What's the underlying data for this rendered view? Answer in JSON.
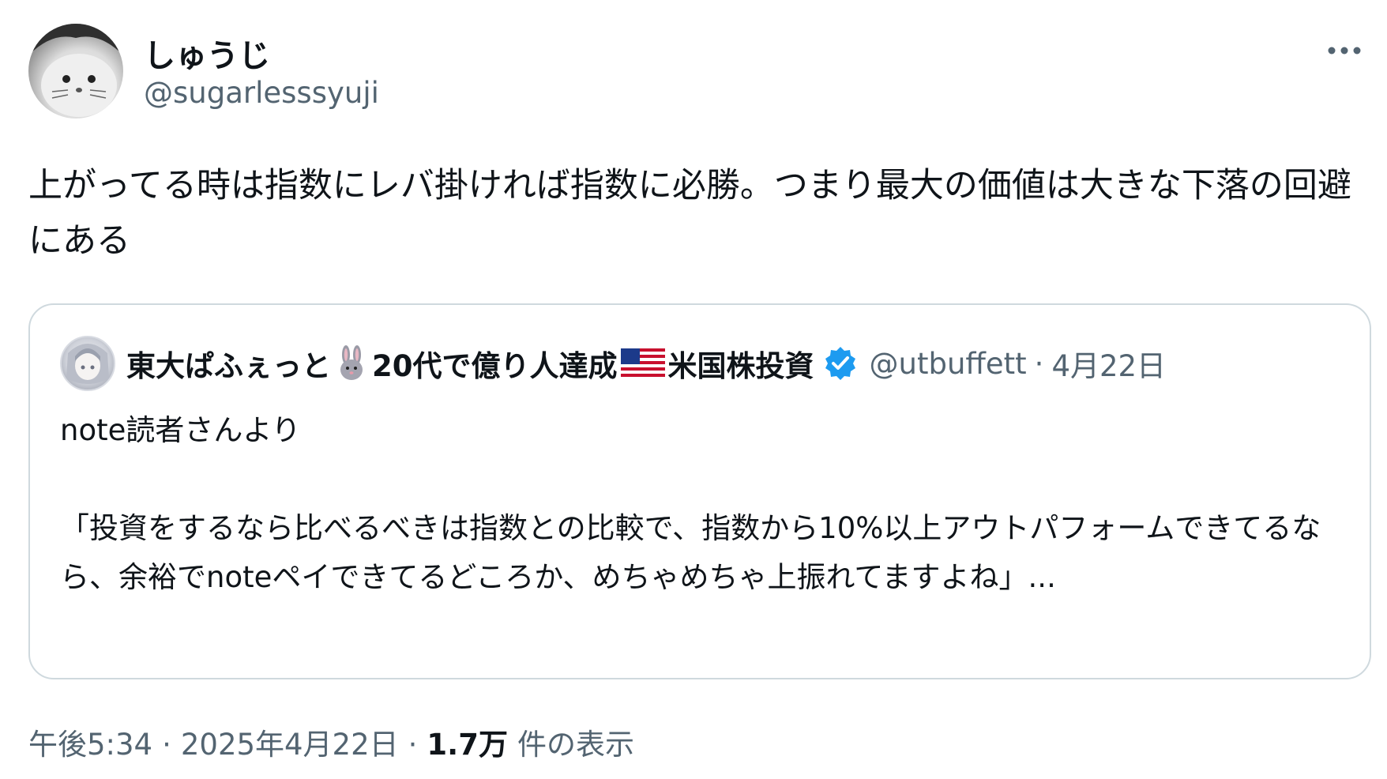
{
  "author": {
    "name": "しゅうじ",
    "handle": "@sugarlesssyuji"
  },
  "tweet": {
    "text": "上がってる時は指数にレバ掛ければ指数に必勝。つまり最大の価値は大きな下落の回避にある"
  },
  "quote": {
    "name_part1": "東大ぱふぇっと",
    "name_part2": "20代で億り人達成",
    "name_part3": "米国株投資",
    "emoji_1": "rabbit-emoji",
    "emoji_2": "us-flag-emoji",
    "handle": "@utbuffett",
    "dot": "·",
    "date": "4月22日",
    "line1": "note読者さんより",
    "line2": "「投資をするなら比べるべきは指数との比較で、指数から10%以上アウトパフォームできてるなら、余裕でnoteペイできてるどころか、めちゃめちゃ上振れてますよね」..."
  },
  "meta": {
    "time": "午後5:34",
    "sep1": "·",
    "date": "2025年4月22日",
    "sep2": "·",
    "views_count": "1.7万",
    "views_label": "件の表示"
  },
  "colors": {
    "text_primary": "#0f1419",
    "text_secondary": "#536471",
    "border": "#cfd9de",
    "verified": "#1d9bf0"
  }
}
